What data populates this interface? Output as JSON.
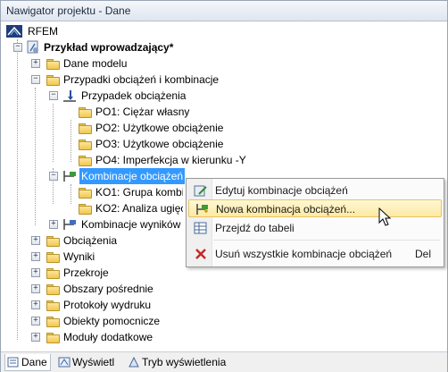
{
  "window": {
    "title": "Nawigator projektu - Dane"
  },
  "tree": {
    "root": "RFEM",
    "project": "Przykład wprowadzający*",
    "model_data": "Dane modelu",
    "load_cases_combos": "Przypadki obciążeń i kombinacje",
    "load_cases": "Przypadek obciążenia",
    "lc": [
      "PO1: Ciężar własny",
      "PO2: Użytkowe obciążenie",
      "PO3: Użytkowe obciążenie",
      "PO4: Imperfekcja w kierunku -Y"
    ],
    "load_combinations": "Kombinacje obciążeń",
    "co": [
      "KO1: Grupa kombi",
      "KO2: Analiza ugięc"
    ],
    "result_combinations": "Kombinacje wyników",
    "others": [
      "Obciążenia",
      "Wyniki",
      "Przekroje",
      "Obszary pośrednie",
      "Protokoły wydruku",
      "Obiekty pomocnicze",
      "Moduły dodatkowe"
    ]
  },
  "context_menu": {
    "edit": "Edytuj kombinacje obciążeń",
    "new": "Nowa kombinacja obciążeń...",
    "goto": "Przejdź do tabeli",
    "delete_all": "Usuń wszystkie kombinacje obciążeń",
    "delete_shortcut": "Del"
  },
  "bottom_tabs": {
    "data": "Dane",
    "display": "Wyświetl",
    "views": "Tryb wyświetlenia"
  },
  "colors": {
    "selection": "#3399ff",
    "menu_highlight": "#fde9a2"
  }
}
